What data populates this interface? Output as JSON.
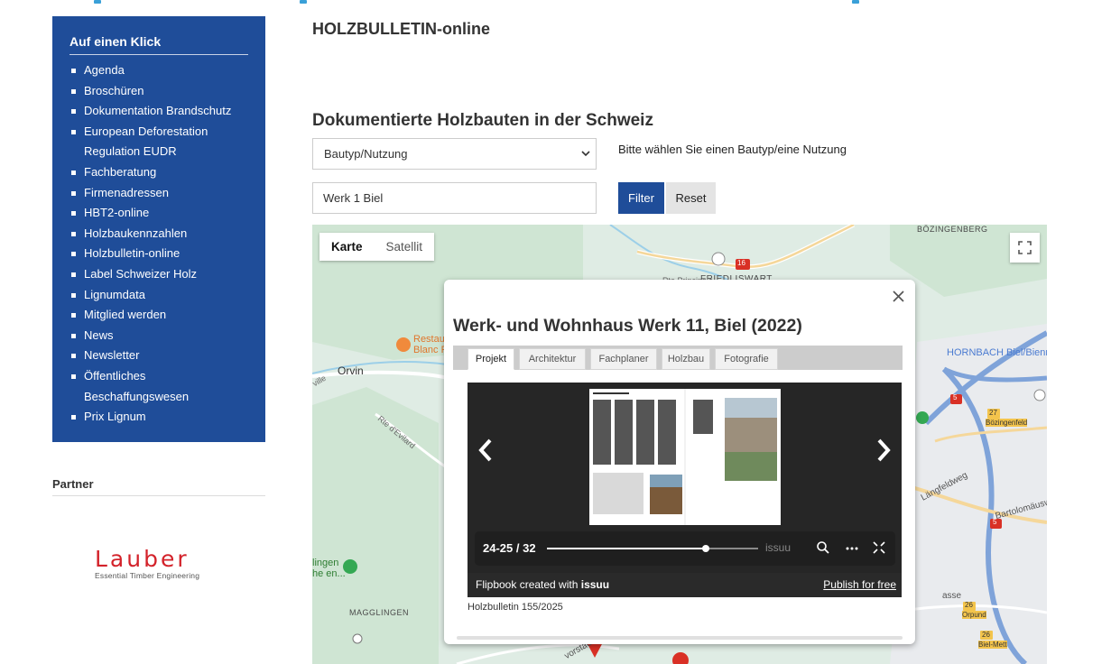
{
  "sidebar": {
    "title": "Auf einen Klick",
    "items": [
      {
        "label": "Agenda"
      },
      {
        "label": "Broschüren"
      },
      {
        "label": "Dokumentation Brandschutz"
      },
      {
        "label": "European Deforestation",
        "label_cont": "Regulation EUDR"
      },
      {
        "label": "Fachberatung"
      },
      {
        "label": "Firmenadressen"
      },
      {
        "label": "HBT2-online"
      },
      {
        "label": "Holzbaukennzahlen"
      },
      {
        "label": "Holzbulletin-online"
      },
      {
        "label": "Label Schweizer Holz"
      },
      {
        "label": "Lignumdata"
      },
      {
        "label": "Mitglied werden"
      },
      {
        "label": "News"
      },
      {
        "label": "Newsletter"
      },
      {
        "label": "Öffentliches",
        "label_cont": "Beschaffungswesen"
      },
      {
        "label": "Prix Lignum"
      }
    ]
  },
  "partner": {
    "title": "Partner",
    "logo_word": "Lauber",
    "logo_tagline": "Essential Timber Engineering"
  },
  "main": {
    "page_title": "HOLZBULLETIN-online",
    "section_title": "Dokumentierte Holzbauten in der Schweiz",
    "type_select": {
      "value": "Bautyp/Nutzung"
    },
    "type_hint": "Bitte wählen Sie einen Bautyp/eine Nutzung",
    "search_value": "Werk 1 Biel",
    "filter_label": "Filter",
    "reset_label": "Reset"
  },
  "map": {
    "type_karte": "Karte",
    "type_satellit": "Satellit",
    "labels": {
      "bozingenberg": "BÖZINGENBERG",
      "friedliswart": "FRIEDLISWART",
      "rte_principale": "Rte Principale",
      "route_16": "16",
      "orvin": "Orvin",
      "restaurant": "Restau",
      "restaurant2": "Blanc F",
      "hornbach": "HORNBACH Biel/Bienn",
      "route_5a": "5",
      "route_5b": "5",
      "exit_27": "27",
      "bozingenfeld": "Bözingenfeld",
      "langfeldweg": "Längfeldweg",
      "bartolomausweg": "Bartolomäusw",
      "rte_devilard": "Rte d'Evilard",
      "ville": "ville",
      "lingen": "lingen",
      "he_en": "he en...",
      "magglingen": "MAGGLINGEN",
      "exit_26a": "26",
      "orpund": "Orpund",
      "exit_26b": "26",
      "biel_mett": "Biel-Mett",
      "asse": "asse",
      "vorstadt": "vorstadt"
    }
  },
  "infowindow": {
    "title": "Werk- und Wohnhaus Werk 11, Biel (2022)",
    "tabs": [
      "Projekt",
      "Architektur",
      "Fachplaner",
      "Holzbau",
      "Fotografie"
    ],
    "active_tab": "Projekt",
    "viewer": {
      "page_indicator": "24-25 / 32",
      "progress_fraction": 0.75,
      "watermark": "issuu",
      "footer_left": "Flipbook created with",
      "footer_brand": "issuu",
      "footer_right": "Publish for free"
    },
    "caption": "Holzbulletin 155/2025"
  },
  "colors": {
    "sidebar_bg": "#1f4d99",
    "filter_btn": "#1f4d99",
    "map_bg": "#dfece4",
    "marker_red": "#d93025"
  },
  "icons": {
    "close": "close-icon",
    "fullscreen": "fullscreen-icon",
    "prev": "chevron-left-icon",
    "next": "chevron-right-icon",
    "search": "search-icon",
    "more": "more-icon",
    "expand": "expand-icon"
  }
}
